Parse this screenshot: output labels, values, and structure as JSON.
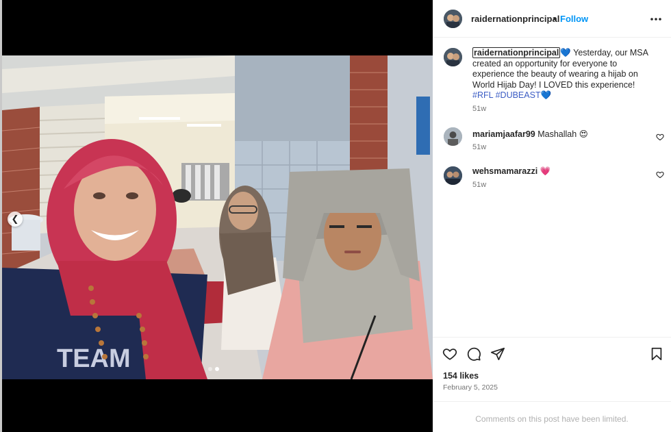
{
  "post": {
    "username": "raidernationprincipal",
    "separator": "•",
    "follow_label": "Follow",
    "more_icon": "more-horizontal-icon"
  },
  "caption": {
    "username": "raidernationprincipal",
    "heart": "💙",
    "text": " Yesterday, our MSA created an opportunity for everyone to experience the beauty of wearing a hijab on World Hijab Day! I LOVED this experience! ",
    "hashtags": [
      "#RFL",
      "#DUBEAST"
    ],
    "heart_end": "💙",
    "age": "51w"
  },
  "comments": [
    {
      "username": "mariamjaafar99",
      "text": "Mashallah",
      "emoji": "😍",
      "age": "51w"
    },
    {
      "username": "wehsmamarazzi",
      "text": "",
      "emoji": "💗",
      "age": "51w"
    }
  ],
  "actions": {
    "like_icon": "heart-outline-icon",
    "comment_icon": "comment-bubble-icon",
    "share_icon": "share-paper-plane-icon",
    "save_icon": "bookmark-icon",
    "likes_text": "154 likes",
    "date": "February 5, 2025"
  },
  "footer": {
    "limited_text": "Comments on this post have been limited."
  },
  "media": {
    "prev_icon": "chevron-left-icon",
    "carousel_index": 1,
    "carousel_total": 2,
    "shirt_text": "TEAM"
  },
  "colors": {
    "accent": "#0095f6",
    "hashtag": "#3b5cc4",
    "muted": "#737373"
  }
}
